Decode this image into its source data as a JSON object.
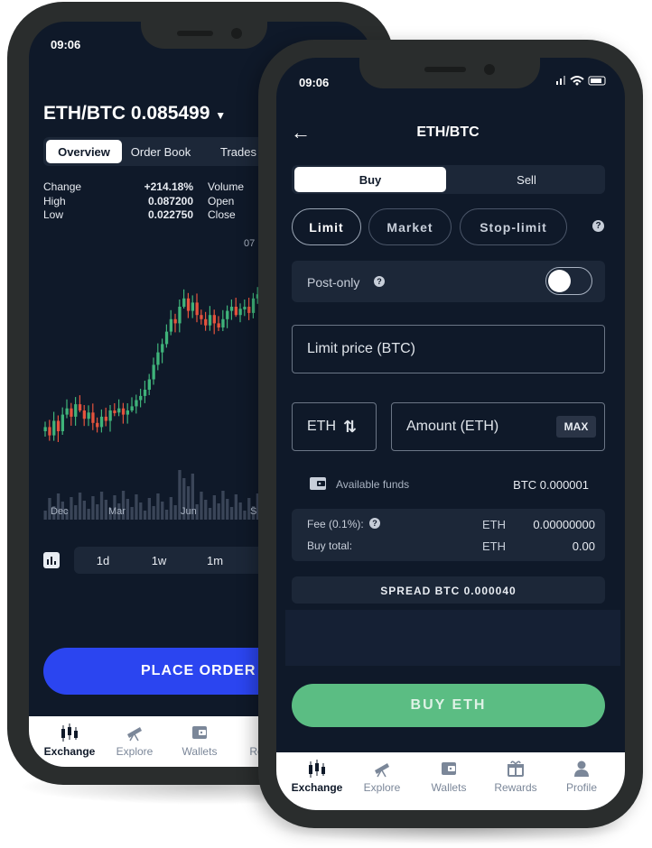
{
  "back_phone": {
    "status_time": "09:06",
    "pair_title": "ETH/BTC 0.085499",
    "tabs": [
      "Overview",
      "Order Book",
      "Trades"
    ],
    "stats": {
      "labels": [
        "Change",
        "High",
        "Low"
      ],
      "values": [
        "+214.18%",
        "0.087200",
        "0.022750"
      ],
      "labels2": [
        "Volume",
        "Open",
        "Close"
      ]
    },
    "chart_partial_label": "07",
    "x_axis": [
      "Dec",
      "Mar",
      "Jun",
      "S"
    ],
    "timeframes": [
      "1d",
      "1w",
      "1m"
    ],
    "place_order": "PLACE ORDER",
    "nav": [
      "Exchange",
      "Explore",
      "Wallets",
      "Re"
    ]
  },
  "front_phone": {
    "status_time": "09:06",
    "title": "ETH/BTC",
    "side_tabs": [
      "Buy",
      "Sell"
    ],
    "order_types": [
      "Limit",
      "Market",
      "Stop-limit"
    ],
    "post_only": "Post-only",
    "limit_price_placeholder": "Limit price (BTC)",
    "currency_toggle": "ETH",
    "amount_placeholder": "Amount (ETH)",
    "max_label": "MAX",
    "available_funds_label": "Available funds",
    "available_funds_value": "BTC 0.000001",
    "fee_label": "Fee (0.1%):",
    "fee_currency": "ETH",
    "fee_value": "0.00000000",
    "buy_total_label": "Buy total:",
    "buy_total_currency": "ETH",
    "buy_total_value": "0.00",
    "spread": "SPREAD BTC 0.000040",
    "buy_button": "BUY ETH",
    "nav": [
      "Exchange",
      "Explore",
      "Wallets",
      "Rewards",
      "Profile"
    ]
  },
  "colors": {
    "screen_bg": "#0f1929",
    "accent_blue": "#2b45f0",
    "buy_green": "#5bbd83",
    "candle_green": "#3fb37a",
    "candle_red": "#e5533d"
  }
}
